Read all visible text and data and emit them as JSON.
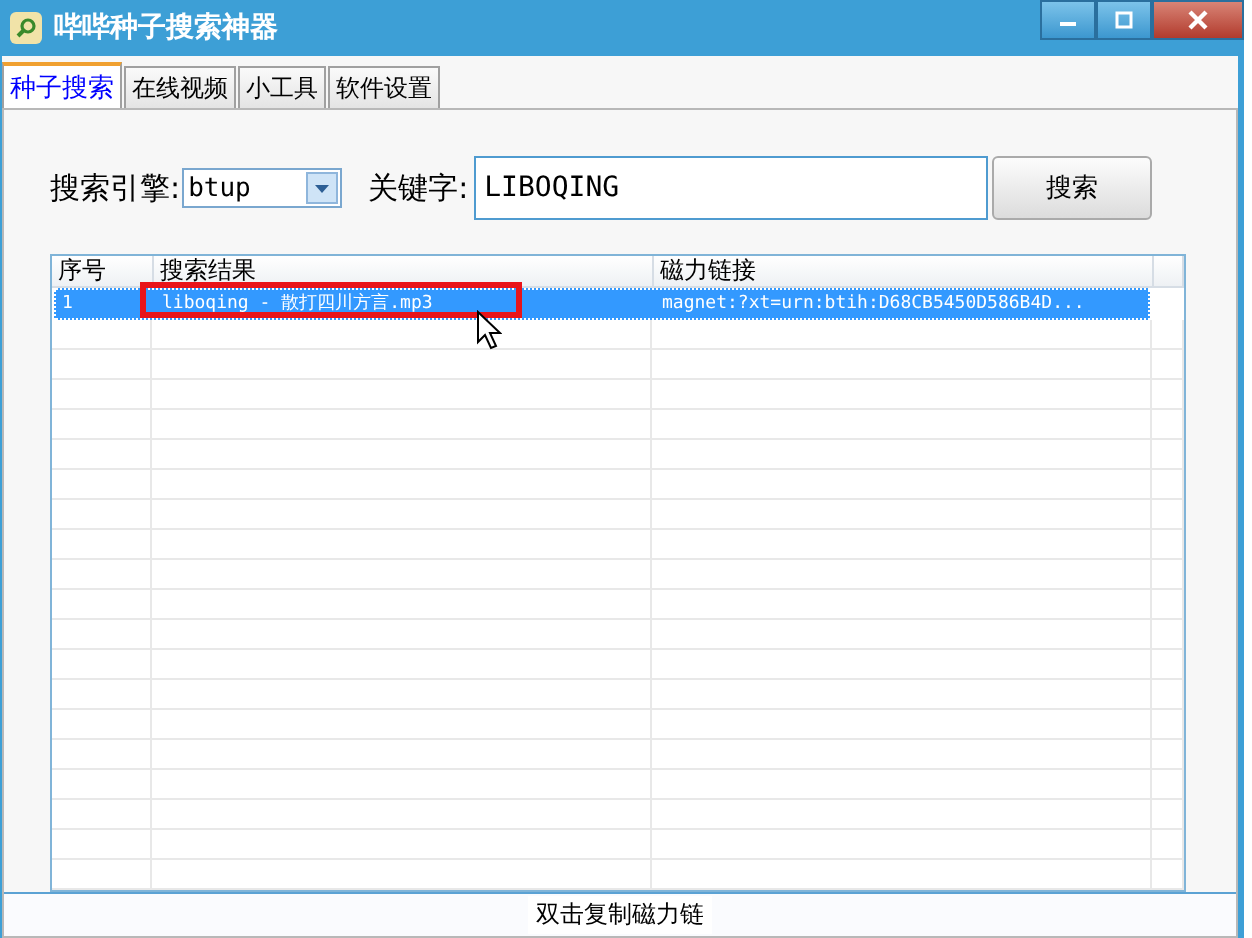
{
  "window": {
    "title": "哔哔种子搜索神器"
  },
  "tabs": [
    {
      "label": "种子搜索",
      "selected": true
    },
    {
      "label": "在线视频",
      "selected": false
    },
    {
      "label": "小工具",
      "selected": false
    },
    {
      "label": "软件设置",
      "selected": false
    }
  ],
  "search": {
    "engine_label": "搜索引擎:",
    "engine": "btup",
    "keyword_label": "关键字:",
    "keyword": "LIBOQING",
    "button": "搜索"
  },
  "table": {
    "columns": [
      "序号",
      "搜索结果",
      "磁力链接"
    ],
    "rows": [
      {
        "cells": [
          "1",
          "liboqing - 散打四川方言.mp3",
          "magnet:?xt=urn:btih:D68CB5450D586B4D..."
        ],
        "selected": true,
        "highlighted": true
      }
    ]
  },
  "status_bar": "双击复制磁力链"
}
